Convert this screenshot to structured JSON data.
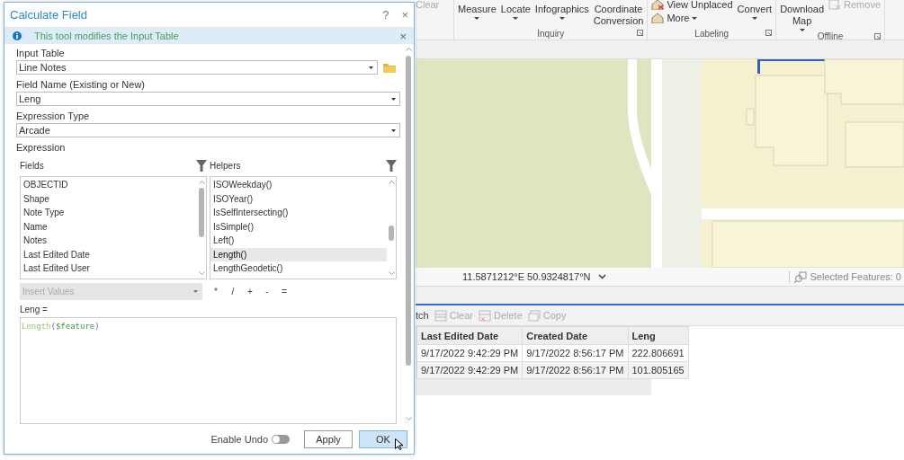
{
  "ribbon": {
    "partial_items": [
      {
        "label": "Clear",
        "disabled": true
      }
    ],
    "groups": [
      {
        "label": "Inquiry",
        "items": [
          {
            "label": "Measure",
            "kind": "large",
            "caret": true,
            "disabled": false
          },
          {
            "label": "Locate",
            "kind": "large",
            "caret": true,
            "disabled": false
          },
          {
            "label": "Infographics",
            "kind": "large",
            "caret": true,
            "disabled": false
          },
          {
            "label": "Coordinate Conversion",
            "kind": "large",
            "caret": false,
            "disabled": false
          }
        ]
      },
      {
        "label": "Labeling",
        "items": [
          {
            "label": "View Unplaced",
            "kind": "small",
            "caret": false,
            "disabled": false
          },
          {
            "label": "More",
            "kind": "small",
            "caret": true,
            "disabled": false
          },
          {
            "label": "Convert",
            "kind": "large",
            "caret": true,
            "disabled": false
          }
        ]
      },
      {
        "label": "Offline",
        "items": [
          {
            "label": "Download Map",
            "kind": "large",
            "caret": true,
            "disabled": false
          },
          {
            "label": "Remove",
            "kind": "small",
            "caret": false,
            "disabled": true
          }
        ]
      }
    ]
  },
  "status_bar": {
    "coordinates": "11.5871212°E 50.9324817°N",
    "selected_features": "Selected Features: 0"
  },
  "table_toolbar": {
    "partial_label": "tch",
    "tools": [
      {
        "label": "Clear",
        "kind": "clear",
        "disabled": true
      },
      {
        "label": "Delete",
        "kind": "delete",
        "disabled": true
      },
      {
        "label": "Copy",
        "kind": "copy",
        "disabled": true
      }
    ]
  },
  "table": {
    "columns": [
      "Last Edited Date",
      "Created Date",
      "Leng"
    ],
    "rows": [
      {
        "cells": [
          "9/17/2022 9:42:29 PM",
          "9/17/2022 8:56:17 PM",
          "222.806691"
        ]
      },
      {
        "cells": [
          "9/17/2022 9:42:29 PM",
          "9/17/2022 8:56:17 PM",
          "101.805165"
        ]
      }
    ]
  },
  "dialog": {
    "title": "Calculate Field",
    "help": "?",
    "close": "×",
    "info": {
      "text": "This tool modifies the Input Table",
      "close": "×"
    },
    "params": [
      {
        "label": "Input Table",
        "value": "Line Notes",
        "browse": true
      },
      {
        "label": "Field Name (Existing or New)",
        "value": "Leng",
        "browse": false
      },
      {
        "label": "Expression Type",
        "value": "Arcade",
        "browse": false
      }
    ],
    "expression_label": "Expression",
    "fields": {
      "title": "Fields",
      "items": [
        {
          "text": "OBJECTID",
          "selected": false
        },
        {
          "text": "Shape",
          "selected": false
        },
        {
          "text": "Note Type",
          "selected": false
        },
        {
          "text": "Name",
          "selected": false
        },
        {
          "text": "Notes",
          "selected": false
        },
        {
          "text": "Last Edited Date",
          "selected": false
        },
        {
          "text": "Last Edited User",
          "selected": false
        }
      ]
    },
    "helpers": {
      "title": "Helpers",
      "items": [
        {
          "text": "ISOWeekday()",
          "selected": false
        },
        {
          "text": "ISOYear()",
          "selected": false
        },
        {
          "text": "IsSelfIntersecting()",
          "selected": false
        },
        {
          "text": "IsSimple()",
          "selected": false
        },
        {
          "text": "Left()",
          "selected": false
        },
        {
          "text": "Length()",
          "selected": true
        },
        {
          "text": "LengthGeodetic()",
          "selected": false
        }
      ]
    },
    "insert_values": {
      "placeholder": "Insert Values",
      "disabled": true
    },
    "operators": [
      "*",
      "/",
      "+",
      "-",
      "="
    ],
    "target_label": "Leng =",
    "code": [
      {
        "text": "Length",
        "kind": "function"
      },
      {
        "text": "(",
        "kind": "paren"
      },
      {
        "text": "$feature",
        "kind": "variable"
      },
      {
        "text": ")",
        "kind": "paren"
      }
    ],
    "enable_undo": {
      "label": "Enable Undo",
      "on": false
    },
    "buttons": [
      {
        "label": "Apply",
        "focused": false
      },
      {
        "label": "OK",
        "focused": true
      }
    ]
  }
}
